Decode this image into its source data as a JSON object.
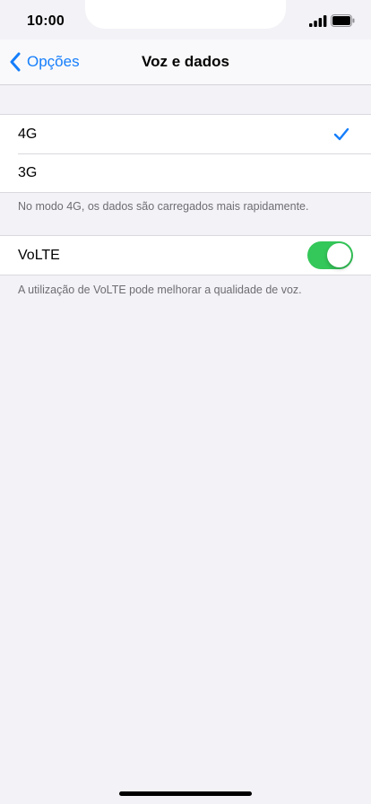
{
  "status_bar": {
    "time": "10:00",
    "icons": [
      "signal-icon",
      "battery-icon"
    ]
  },
  "nav": {
    "back_label": "Opções",
    "title": "Voz e dados"
  },
  "network_group": {
    "items": [
      {
        "label": "4G",
        "selected": true
      },
      {
        "label": "3G",
        "selected": false
      }
    ],
    "footer": "No modo 4G, os dados são carregados mais rapidamente."
  },
  "volte_group": {
    "label": "VoLTE",
    "toggle_on": true,
    "footer": "A utilização de VoLTE pode melhorar a qualidade de voz."
  },
  "colors": {
    "accent": "#157efb",
    "toggle_on": "#34c759",
    "background": "#f2f2f7"
  }
}
